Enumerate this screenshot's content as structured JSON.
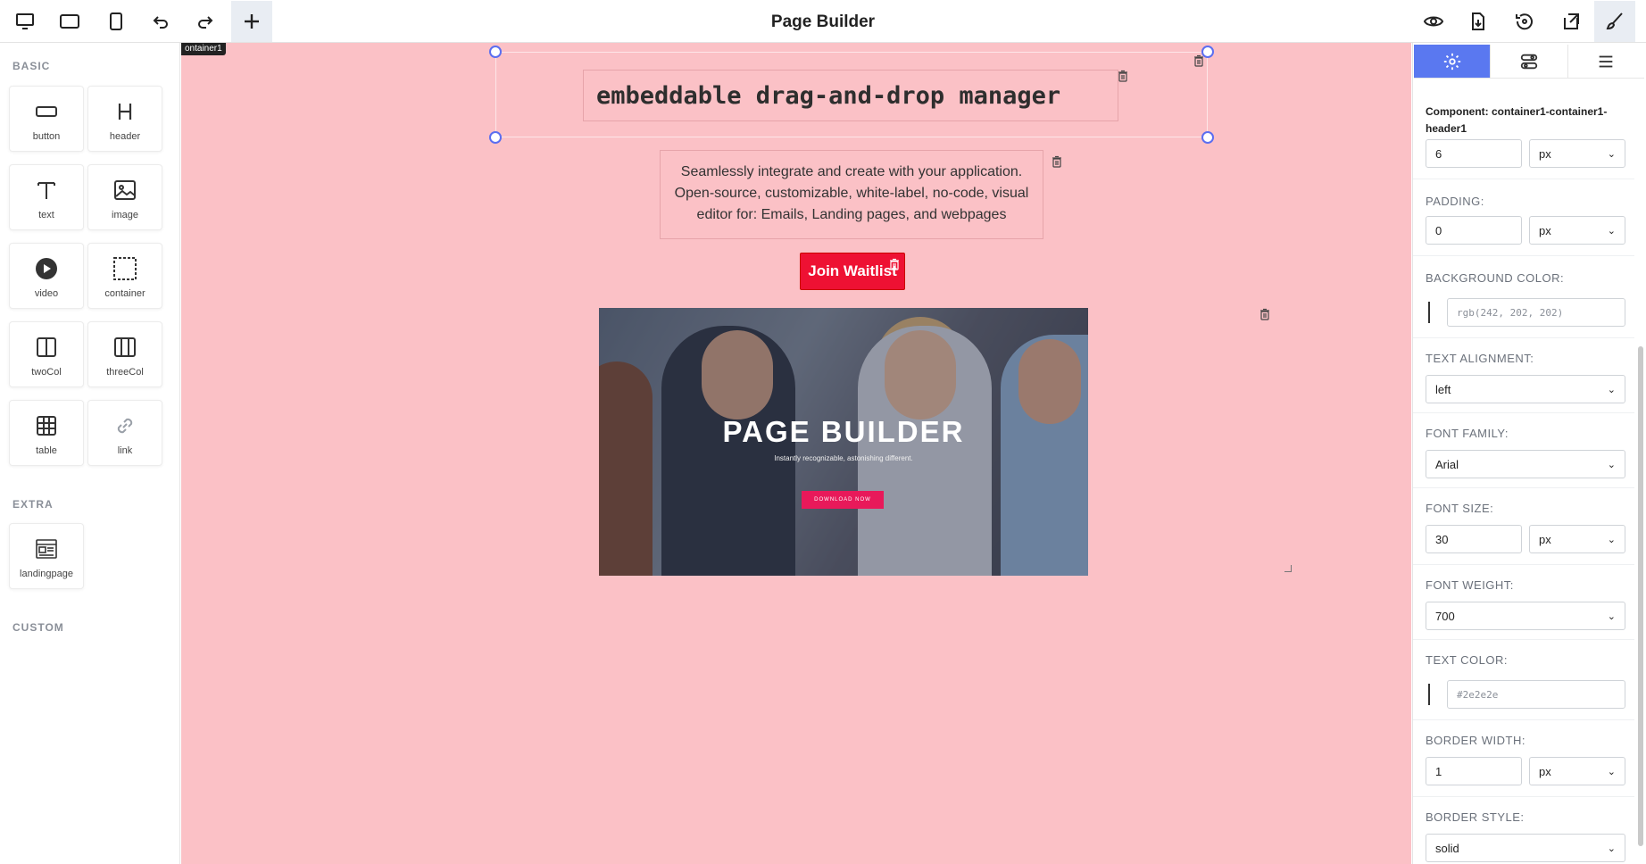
{
  "app": {
    "title": "Page Builder"
  },
  "toolbar": {
    "left_icons": [
      "desktop-icon",
      "tablet-landscape-icon",
      "mobile-icon",
      "undo-icon",
      "redo-icon",
      "plus-icon"
    ],
    "right_icons": [
      "eye-icon",
      "download-icon",
      "reset-icon",
      "export-icon",
      "brush-icon"
    ]
  },
  "left_panel": {
    "basic_title": "BASIC",
    "extra_title": "EXTRA",
    "custom_title": "CUSTOM",
    "basic_blocks": [
      {
        "label": "button",
        "icon": "button-icon"
      },
      {
        "label": "header",
        "icon": "heading-icon"
      },
      {
        "label": "text",
        "icon": "text-icon"
      },
      {
        "label": "image",
        "icon": "image-icon"
      },
      {
        "label": "video",
        "icon": "video-icon"
      },
      {
        "label": "container",
        "icon": "container-icon"
      },
      {
        "label": "twoCol",
        "icon": "two-column-icon"
      },
      {
        "label": "threeCol",
        "icon": "three-column-icon"
      },
      {
        "label": "table",
        "icon": "table-icon"
      },
      {
        "label": "link",
        "icon": "link-icon"
      }
    ],
    "extra_blocks": [
      {
        "label": "landingpage",
        "icon": "landingpage-icon"
      }
    ]
  },
  "canvas": {
    "background": "#fbc1c6",
    "breadcrumb": "ontainer1",
    "header_text": "embeddable drag-and-drop manager",
    "paragraph_lines": [
      "Seamlessly integrate and create with your application.",
      "Open-source, customizable, white-label, no-code, visual",
      "editor for: Emails, Landing pages, and webpages"
    ],
    "cta_label": "Join Waitlist",
    "hero": {
      "title": "PAGE BUILDER",
      "subtitle": "Instantly recognizable, astonishing different.",
      "button": "DOWNLOAD NOW"
    }
  },
  "right_panel": {
    "tabs": [
      "settings-icon",
      "layers-icon",
      "menu-icon"
    ],
    "component_label": "Component: container1-container1-header1",
    "margin": {
      "value": "6",
      "unit": "px"
    },
    "padding": {
      "label": "PADDING:",
      "value": "0",
      "unit": "px"
    },
    "background_color": {
      "label": "BACKGROUND COLOR:",
      "value": "rgb(242, 202, 202)"
    },
    "text_alignment": {
      "label": "TEXT ALIGNMENT:",
      "value": "left"
    },
    "font_family": {
      "label": "FONT FAMILY:",
      "value": "Arial"
    },
    "font_size": {
      "label": "FONT SIZE:",
      "value": "30",
      "unit": "px"
    },
    "font_weight": {
      "label": "FONT WEIGHT:",
      "value": "700"
    },
    "text_color": {
      "label": "TEXT COLOR:",
      "value": "#2e2e2e"
    },
    "border_width": {
      "label": "BORDER WIDTH:",
      "value": "1",
      "unit": "px"
    },
    "border_style": {
      "label": "BORDER STYLE:",
      "value": "solid"
    }
  },
  "colors": {
    "accent": "#5a78f0",
    "cta": "#ee1133",
    "canvas_bg": "#fbc1c6"
  }
}
